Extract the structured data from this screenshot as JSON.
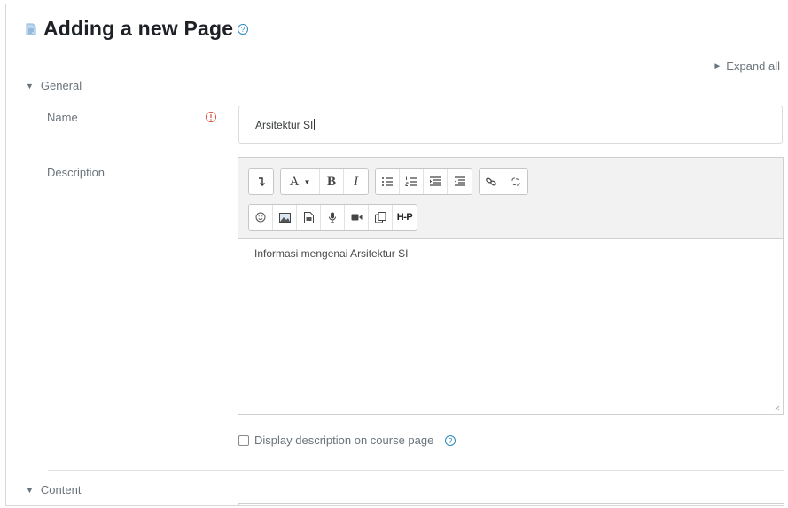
{
  "page": {
    "title": "Adding a new Page",
    "icon": "page-icon",
    "help_icon": "question-circle-icon"
  },
  "expand_all": "Expand all",
  "sections": {
    "general": "General",
    "content": "Content"
  },
  "fields": {
    "name": {
      "label": "Name",
      "required_icon": "exclamation-circle-icon",
      "value": "Arsitektur SI"
    },
    "description": {
      "label": "Description",
      "content": "Informasi mengenai Arsitektur SI"
    }
  },
  "toolbar": {
    "row1": [
      [
        "collapse-icon"
      ],
      [
        "font-style-icon",
        "bold-icon",
        "italic-icon"
      ],
      [
        "unordered-list-icon",
        "ordered-list-icon",
        "indent-icon",
        "outdent-icon"
      ],
      [
        "link-icon",
        "unlink-icon"
      ]
    ],
    "row2": [
      [
        "emoticon-icon",
        "image-icon",
        "media-icon",
        "record-audio-icon",
        "record-video-icon",
        "manage-files-icon",
        "h5p-icon"
      ]
    ],
    "labels": {
      "font": "A",
      "bold": "B",
      "italic": "I",
      "h5p": "H-P"
    }
  },
  "display_description": {
    "label": "Display description on course page",
    "checked": false
  },
  "colors": {
    "help": "#2b88c0",
    "required": "#d94f3d",
    "page_icon": "#8db5d9"
  }
}
